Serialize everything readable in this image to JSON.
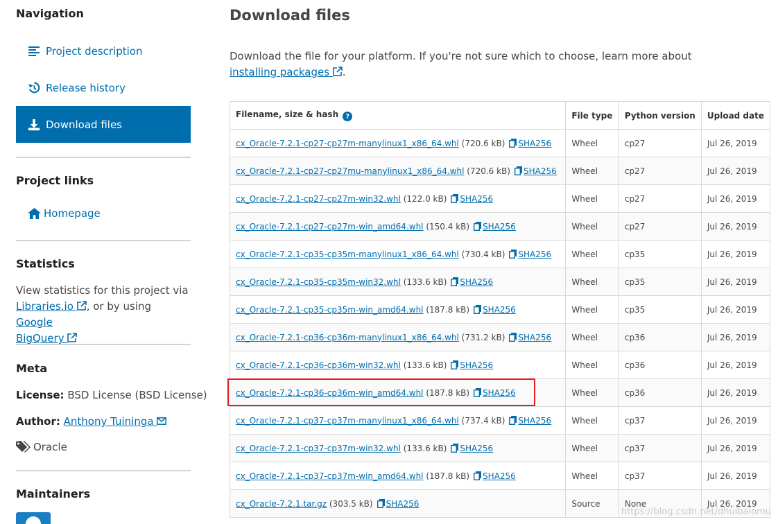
{
  "sidebar": {
    "nav_heading": "Navigation",
    "nav_items": [
      {
        "label": "Project description",
        "icon": "align-left-icon"
      },
      {
        "label": "Release history",
        "icon": "history-icon"
      },
      {
        "label": "Download files",
        "icon": "download-icon",
        "active": true
      }
    ],
    "links_heading": "Project links",
    "homepage_label": "Homepage",
    "stats_heading": "Statistics",
    "stats_text_1": "View statistics for this project via",
    "stats_link_libraries": "Libraries.io",
    "stats_text_2": ", or by using",
    "stats_link_google": "Google",
    "stats_link_bigquery": "BigQuery",
    "meta_heading": "Meta",
    "license_label": "License:",
    "license_value": "BSD License (BSD License)",
    "author_label": "Author:",
    "author_value": "Anthony Tuininga",
    "tag_value": "Oracle",
    "maintainers_heading": "Maintainers"
  },
  "main": {
    "title": "Download files",
    "intro_text": "Download the file for your platform. If you're not sure which to choose, learn more about",
    "intro_link_1": "installing",
    "intro_link_2": "packages",
    "intro_end": ".",
    "headers": {
      "filename": "Filename, size & hash",
      "type": "File type",
      "python": "Python version",
      "date": "Upload date"
    },
    "sha_label": "SHA256",
    "rows": [
      {
        "file": "cx_Oracle-7.2.1-cp27-cp27m-manylinux1_x86_64.whl",
        "size": "(720.6 kB)",
        "type": "Wheel",
        "py": "cp27",
        "date": "Jul 26, 2019"
      },
      {
        "file": "cx_Oracle-7.2.1-cp27-cp27mu-manylinux1_x86_64.whl",
        "size": "(720.6 kB)",
        "type": "Wheel",
        "py": "cp27",
        "date": "Jul 26, 2019"
      },
      {
        "file": "cx_Oracle-7.2.1-cp27-cp27m-win32.whl",
        "size": "(122.0 kB)",
        "type": "Wheel",
        "py": "cp27",
        "date": "Jul 26, 2019"
      },
      {
        "file": "cx_Oracle-7.2.1-cp27-cp27m-win_amd64.whl",
        "size": "(150.4 kB)",
        "type": "Wheel",
        "py": "cp27",
        "date": "Jul 26, 2019"
      },
      {
        "file": "cx_Oracle-7.2.1-cp35-cp35m-manylinux1_x86_64.whl",
        "size": "(730.4 kB)",
        "type": "Wheel",
        "py": "cp35",
        "date": "Jul 26, 2019"
      },
      {
        "file": "cx_Oracle-7.2.1-cp35-cp35m-win32.whl",
        "size": "(133.6 kB)",
        "type": "Wheel",
        "py": "cp35",
        "date": "Jul 26, 2019"
      },
      {
        "file": "cx_Oracle-7.2.1-cp35-cp35m-win_amd64.whl",
        "size": "(187.8 kB)",
        "type": "Wheel",
        "py": "cp35",
        "date": "Jul 26, 2019"
      },
      {
        "file": "cx_Oracle-7.2.1-cp36-cp36m-manylinux1_x86_64.whl",
        "size": "(731.2 kB)",
        "type": "Wheel",
        "py": "cp36",
        "date": "Jul 26, 2019"
      },
      {
        "file": "cx_Oracle-7.2.1-cp36-cp36m-win32.whl",
        "size": "(133.6 kB)",
        "type": "Wheel",
        "py": "cp36",
        "date": "Jul 26, 2019"
      },
      {
        "file": "cx_Oracle-7.2.1-cp36-cp36m-win_amd64.whl",
        "size": "(187.8 kB)",
        "type": "Wheel",
        "py": "cp36",
        "date": "Jul 26, 2019"
      },
      {
        "file": "cx_Oracle-7.2.1-cp37-cp37m-manylinux1_x86_64.whl",
        "size": "(737.4 kB)",
        "type": "Wheel",
        "py": "cp37",
        "date": "Jul 26, 2019"
      },
      {
        "file": "cx_Oracle-7.2.1-cp37-cp37m-win32.whl",
        "size": "(133.6 kB)",
        "type": "Wheel",
        "py": "cp37",
        "date": "Jul 26, 2019"
      },
      {
        "file": "cx_Oracle-7.2.1-cp37-cp37m-win_amd64.whl",
        "size": "(187.8 kB)",
        "type": "Wheel",
        "py": "cp37",
        "date": "Jul 26, 2019"
      },
      {
        "file": "cx_Oracle-7.2.1.tar.gz",
        "size": "(303.5 kB)",
        "type": "Source",
        "py": "None",
        "date": "Jul 26, 2019"
      }
    ]
  },
  "watermark": "https://blog.csdn.net/dhuibaiomu",
  "colors": {
    "link": "#006dad",
    "highlight": "#e21d1d"
  }
}
